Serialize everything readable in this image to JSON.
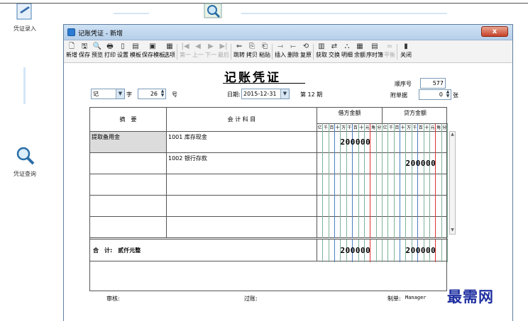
{
  "nav": {
    "entry_label": "凭证录入",
    "query_label": "凭证查询"
  },
  "window": {
    "title": "记账凭证 - 新增",
    "close_label": "x"
  },
  "toolbar": {
    "items": [
      "新增",
      "保存",
      "预览",
      "打印",
      "设置",
      "模板",
      "保存模板",
      "选项",
      "第一",
      "上一",
      "下一",
      "最后",
      "跳转",
      "拷贝",
      "粘贴",
      "插入",
      "删除",
      "复原",
      "获取",
      "交换",
      "明细",
      "余额",
      "序时簿",
      "平衡",
      "关闭"
    ],
    "glyphs": [
      "🗋",
      "🖫",
      "🔍",
      "🖶",
      "▯",
      "▤",
      "▣",
      "▦",
      "|◀",
      "◀",
      "▶",
      "▶|",
      "⇐",
      "⎘",
      "⎗",
      "⤙",
      "⤚",
      "⟲",
      "▥",
      "⇄",
      "⛬",
      "▦",
      "▤",
      "=",
      "▮"
    ],
    "disabled": [
      8,
      9,
      10,
      11,
      23
    ]
  },
  "voucher": {
    "title": "记账凭证",
    "word_value": "记",
    "word_label": "字",
    "number_value": "26",
    "number_label": "号",
    "date_label": "日期:",
    "date_value": "2015-12-31",
    "period_text": "第 12 期",
    "seq_label": "顺序号",
    "seq_value": "577",
    "attach_label": "附单据",
    "attach_value": "0",
    "attach_unit": "张"
  },
  "grid": {
    "col_summary": "摘　要",
    "col_account": "会 计 科 目",
    "col_debit": "借方金额",
    "col_credit": "贷方金额",
    "digit_units": [
      "亿",
      "千",
      "百",
      "十",
      "万",
      "千",
      "百",
      "十",
      "元",
      "角",
      "分"
    ],
    "rows": [
      {
        "summary": "提取备用金",
        "account": "1001 库存现金",
        "debit": "200000",
        "credit": ""
      },
      {
        "summary": "",
        "account": "1002 银行存款",
        "debit": "",
        "credit": "200000"
      },
      {
        "summary": "",
        "account": "",
        "debit": "",
        "credit": ""
      },
      {
        "summary": "",
        "account": "",
        "debit": "",
        "credit": ""
      },
      {
        "summary": "",
        "account": "",
        "debit": "",
        "credit": ""
      }
    ],
    "total_label": "合　计:",
    "total_words": "贰仟元整",
    "total_debit": "200000",
    "total_credit": "200000"
  },
  "footer": {
    "audit_label": "审核:",
    "post_label": "过账:",
    "maker_label": "制单:",
    "maker_value": "Manager"
  },
  "watermark": "最需网"
}
